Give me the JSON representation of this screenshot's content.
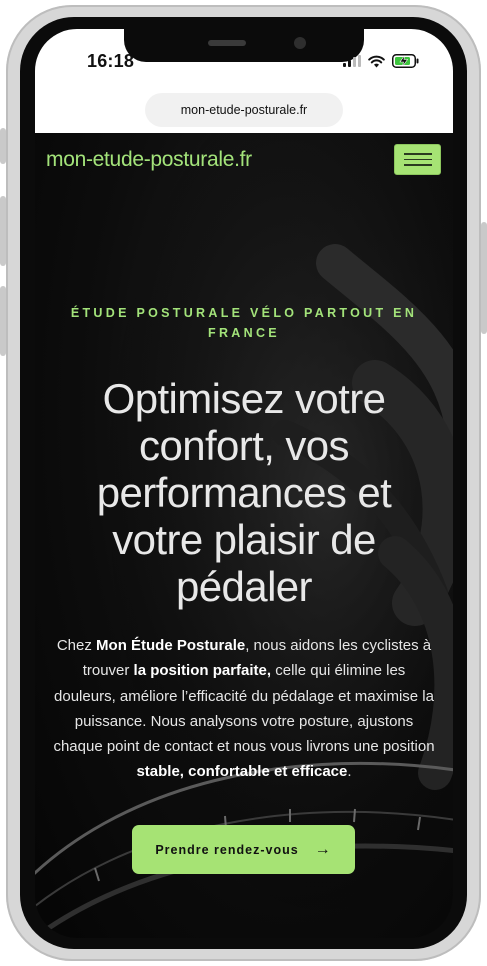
{
  "status_bar": {
    "time": "16:18"
  },
  "browser": {
    "url": "mon-etude-posturale.fr"
  },
  "site": {
    "logo": "mon-etude-posturale.fr",
    "accent_color": "#a6e374"
  },
  "hero": {
    "eyebrow": "ÉTUDE POSTURALE VÉLO PARTOUT EN FRANCE",
    "headline": "Optimisez votre confort, vos performances et votre plaisir de pédaler",
    "intro": [
      {
        "text": "Chez ",
        "bold": false
      },
      {
        "text": "Mon Étude Posturale",
        "bold": true
      },
      {
        "text": ", nous aidons les cyclistes à trouver ",
        "bold": false
      },
      {
        "text": "la position parfaite,",
        "bold": true
      },
      {
        "text": " celle qui élimine les douleurs, améliore l’efficacité du pédalage et maximise la puissance. Nous analysons votre posture, ajustons chaque point de contact et nous vous livrons une position ",
        "bold": false
      },
      {
        "text": "stable, confortable et efficace",
        "bold": true
      },
      {
        "text": ".",
        "bold": false
      }
    ],
    "cta_label": "Prendre rendez-vous",
    "cta_icon": "arrow-right-icon"
  }
}
